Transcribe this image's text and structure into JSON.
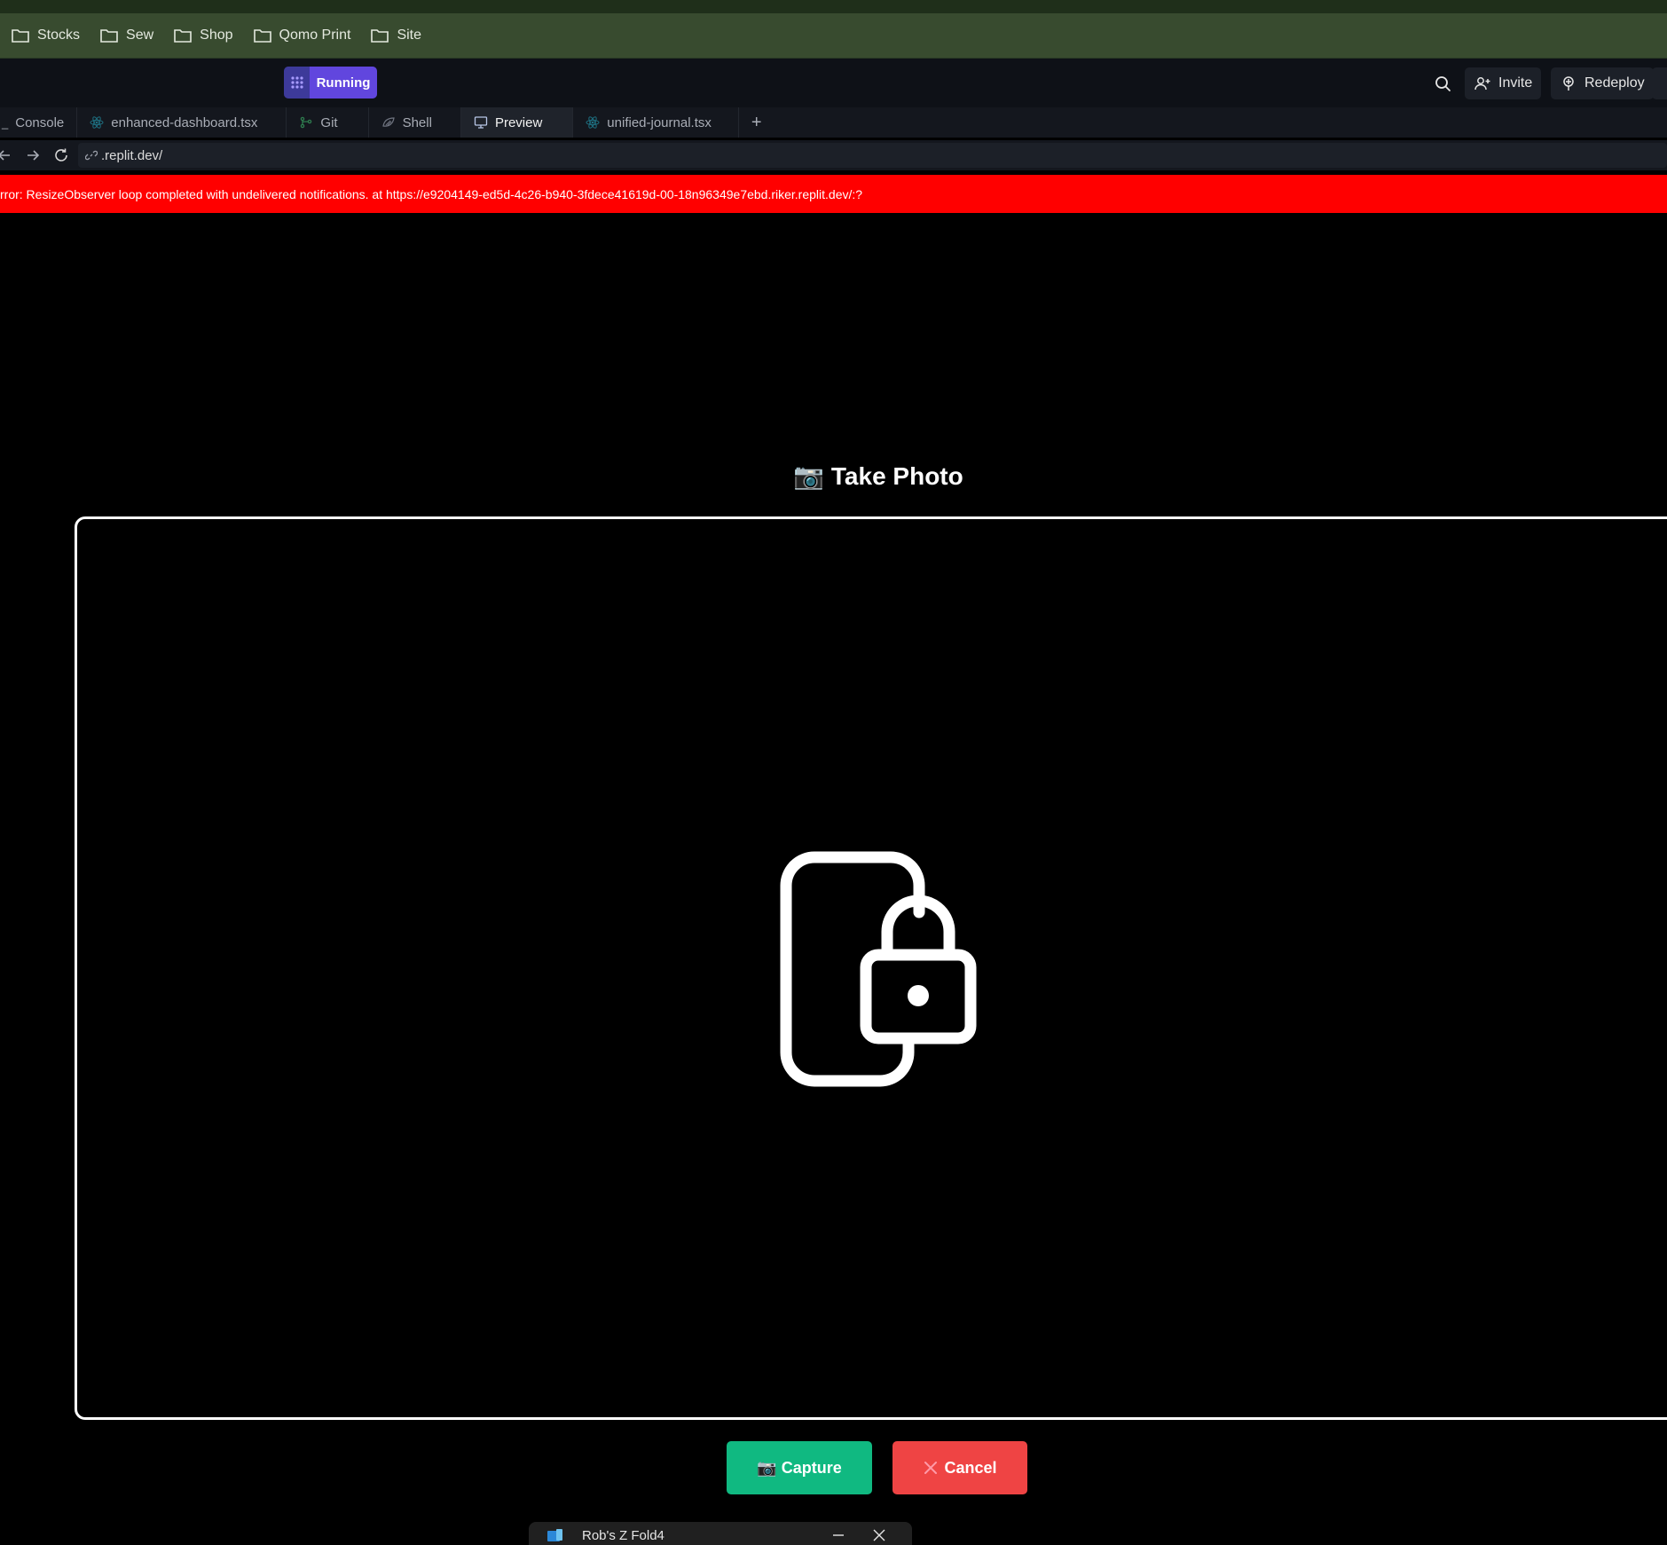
{
  "bookmarks": [
    {
      "label": "Stocks"
    },
    {
      "label": "Sew"
    },
    {
      "label": "Shop"
    },
    {
      "label": "Qomo Print"
    },
    {
      "label": "Site"
    }
  ],
  "header": {
    "status_label": "Running",
    "invite_label": "Invite",
    "redeploy_label": "Redeploy"
  },
  "tabs": [
    {
      "label": "Console",
      "icon": "console-icon"
    },
    {
      "label": "enhanced-dashboard.tsx",
      "icon": "react-icon"
    },
    {
      "label": "Git",
      "icon": "git-icon"
    },
    {
      "label": "Shell",
      "icon": "shell-icon"
    },
    {
      "label": "Preview",
      "icon": "monitor-icon",
      "active": true
    },
    {
      "label": "unified-journal.tsx",
      "icon": "react-icon"
    }
  ],
  "tab_add_label": "+",
  "address": {
    "url": ".replit.dev/"
  },
  "error_banner": {
    "text": "rror: ResizeObserver loop completed with undelivered notifications. at https://e9204149-ed5d-4c26-b940-3fdece41619d-00-18n96349e7ebd.riker.replit.dev/:?"
  },
  "camera": {
    "title": "📷 Take Photo",
    "placeholder_icon": "phone-lock-icon"
  },
  "actions": {
    "capture_label": "📷 Capture",
    "cancel_label": "Cancel"
  },
  "popup": {
    "title": "Rob's Z Fold4"
  },
  "colors": {
    "accent_running": "#6146de",
    "capture": "#10b981",
    "cancel": "#ef4444",
    "error_banner": "#ff0000"
  }
}
